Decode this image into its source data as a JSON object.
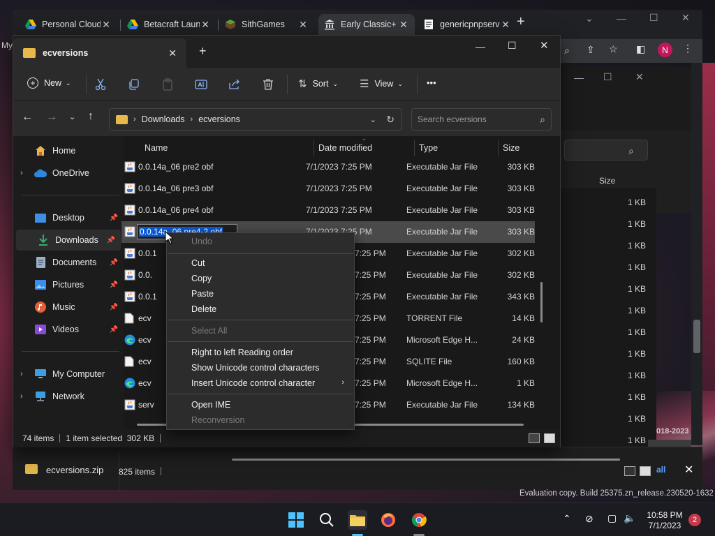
{
  "browser": {
    "tabs": [
      {
        "title": "Personal Cloud",
        "icon": "google-drive-icon"
      },
      {
        "title": "Betacraft Launcher",
        "icon": "google-drive-icon"
      },
      {
        "title": "SithGames",
        "icon": "minecraft-block-icon"
      },
      {
        "title": "Early Classic+",
        "icon": "museum-icon"
      },
      {
        "title": "genericpnpserver",
        "icon": "document-icon"
      }
    ],
    "new_tab": "+",
    "profile_initial": "N",
    "left_edge_text": "My"
  },
  "explorer": {
    "tab_title": "ecversions",
    "new_tab": "+",
    "toolbar": {
      "new_label": "New",
      "sort_label": "Sort",
      "view_label": "View",
      "more_label": "•••"
    },
    "breadcrumb": [
      "Downloads",
      "ecversions"
    ],
    "search_placeholder": "Search ecversions",
    "nav": {
      "home": "Home",
      "onedrive": "OneDrive",
      "desktop": "Desktop",
      "downloads": "Downloads",
      "documents": "Documents",
      "pictures": "Pictures",
      "music": "Music",
      "videos": "Videos",
      "my_computer": "My Computer",
      "network": "Network"
    },
    "columns": {
      "name": "Name",
      "date": "Date modified",
      "type": "Type",
      "size": "Size"
    },
    "rows": [
      {
        "name": "0.0.14a_06 pre2 obf",
        "date": "7/1/2023 7:25 PM",
        "type": "Executable Jar File",
        "size": "303 KB",
        "icon": "jar"
      },
      {
        "name": "0.0.14a_06 pre3 obf",
        "date": "7/1/2023 7:25 PM",
        "type": "Executable Jar File",
        "size": "303 KB",
        "icon": "jar"
      },
      {
        "name": "0.0.14a_06 pre4 obf",
        "date": "7/1/2023 7:25 PM",
        "type": "Executable Jar File",
        "size": "303 KB",
        "icon": "jar"
      },
      {
        "name": "0.0.14a_06 pre4-2 obf",
        "date": "7/1/2023 7:25 PM",
        "type": "Executable Jar File",
        "size": "303 KB",
        "icon": "jar"
      },
      {
        "name": "0.0.1",
        "date": "7:25 PM",
        "type": "Executable Jar File",
        "size": "302 KB",
        "icon": "jar"
      },
      {
        "name": "0.0.",
        "date": "7:25 PM",
        "type": "Executable Jar File",
        "size": "302 KB",
        "icon": "jar"
      },
      {
        "name": "0.0.1",
        "date": "7:25 PM",
        "type": "Executable Jar File",
        "size": "343 KB",
        "icon": "jar"
      },
      {
        "name": "ecv",
        "date": "7:25 PM",
        "type": "TORRENT File",
        "size": "14 KB",
        "icon": "file"
      },
      {
        "name": "ecv",
        "date": "7:25 PM",
        "type": "Microsoft Edge H...",
        "size": "24 KB",
        "icon": "edge"
      },
      {
        "name": "ecv",
        "date": "7:25 PM",
        "type": "SQLITE File",
        "size": "160 KB",
        "icon": "file"
      },
      {
        "name": "ecv",
        "date": "7:25 PM",
        "type": "Microsoft Edge H...",
        "size": "1 KB",
        "icon": "edge"
      },
      {
        "name": "serv",
        "date": "7:25 PM",
        "type": "Executable Jar File",
        "size": "134 KB",
        "icon": "jar"
      }
    ],
    "rename_text": "0.0.14a_06 pre4-2 obf",
    "status": {
      "items": "74 items",
      "selected": "1 item selected  302 KB"
    }
  },
  "context_menu": {
    "undo": "Undo",
    "cut": "Cut",
    "copy": "Copy",
    "paste": "Paste",
    "delete": "Delete",
    "select_all": "Select All",
    "rtl": "Right to left Reading order",
    "show_unicode": "Show Unicode control characters",
    "insert_unicode": "Insert Unicode control character",
    "open_ime": "Open IME",
    "reconversion": "Reconversion"
  },
  "background": {
    "size_header": "Size",
    "kb_values": [
      "1 KB",
      "1 KB",
      "1 KB",
      "1 KB",
      "1 KB",
      "1 KB",
      "1 KB",
      "1 KB",
      "1 KB",
      "1 KB",
      "1 KB",
      "1 KB"
    ],
    "page_text": "018-2023",
    "link_text": "all",
    "zip_name": "ecversions.zip",
    "items_count": "825 items"
  },
  "taskbar": {
    "time": "10:58 PM",
    "date": "7/1/2023",
    "notifications": "2",
    "eval_text": "Evaluation copy. Build 25375.zn_release.230520-1632"
  }
}
